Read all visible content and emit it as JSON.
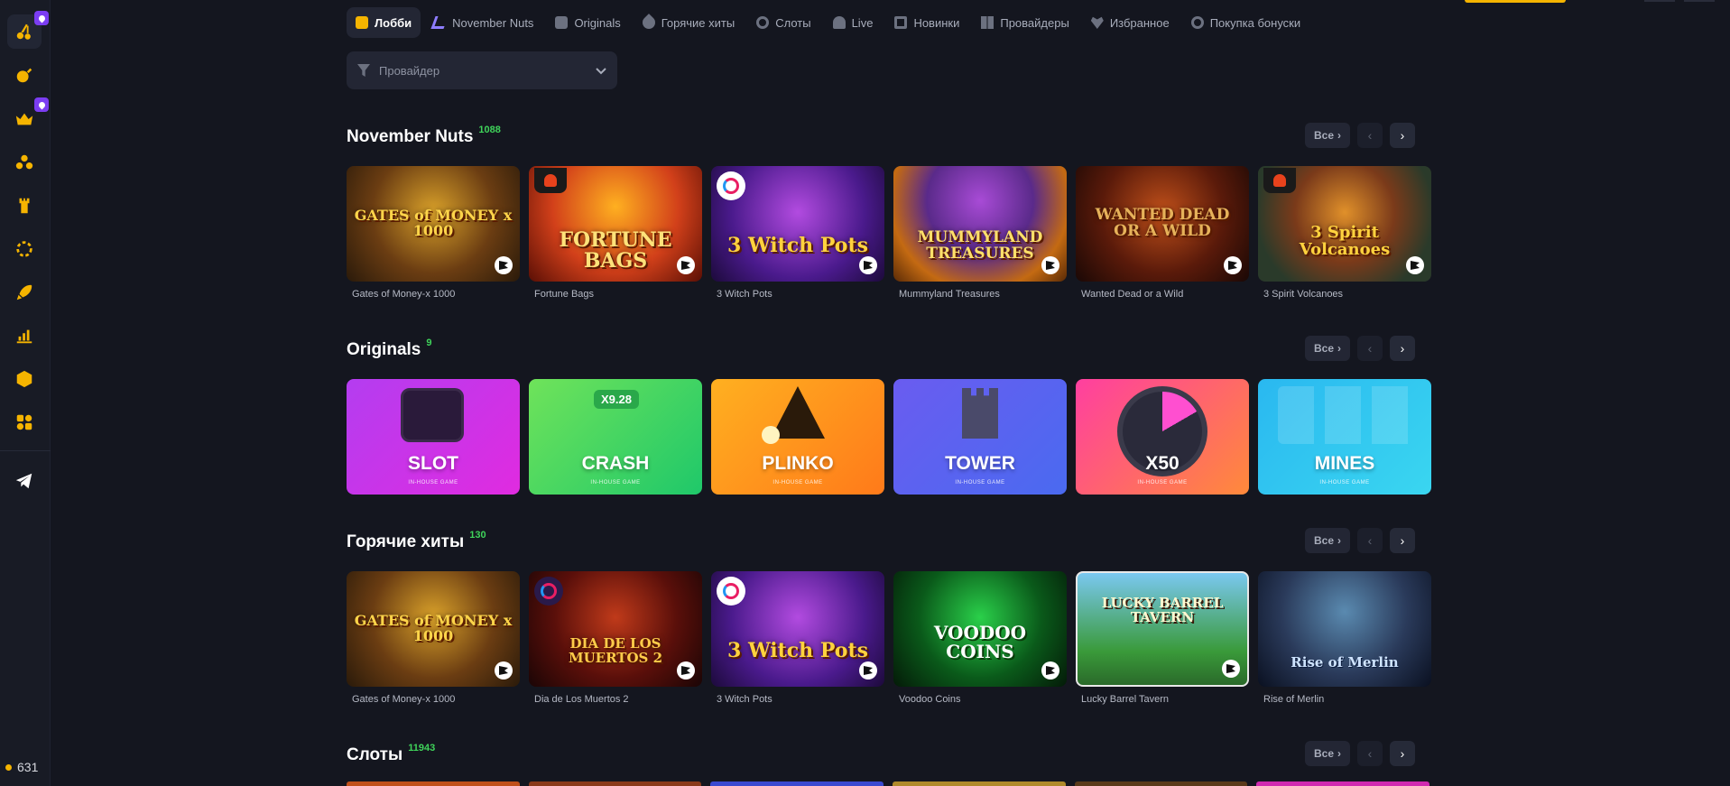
{
  "nav": {
    "items": [
      {
        "label": "Лобби",
        "icon": "lobby-icon",
        "active": true
      },
      {
        "label": "November Nuts",
        "icon": "category-icon",
        "active": false
      },
      {
        "label": "Originals",
        "icon": "originals-icon",
        "active": false
      },
      {
        "label": "Горячие хиты",
        "icon": "flame-icon",
        "active": false
      },
      {
        "label": "Слоты",
        "icon": "cherry-icon",
        "active": false
      },
      {
        "label": "Live",
        "icon": "live-dealer-icon",
        "active": false
      },
      {
        "label": "Новинки",
        "icon": "new-icon",
        "active": false
      },
      {
        "label": "Провайдеры",
        "icon": "providers-icon",
        "active": false
      },
      {
        "label": "Избранное",
        "icon": "heart-icon",
        "active": false
      },
      {
        "label": "Покупка бонуски",
        "icon": "bonus-buy-icon",
        "active": false
      }
    ]
  },
  "provider_select": {
    "placeholder": "Провайдер"
  },
  "sidebar": {
    "icons": [
      "cherry-icon",
      "bomb-icon",
      "crown-icon",
      "poker-chips-icon",
      "tower-icon",
      "wheel-icon",
      "rocket-icon",
      "chart-icon",
      "dice-icon",
      "grid-icon",
      "telegram-icon"
    ],
    "online_count": "631"
  },
  "sections": {
    "nuts": {
      "title": "November Nuts",
      "count": "1088",
      "all_label": "Все",
      "games": [
        {
          "name": "Gates of Money-x 1000",
          "art": "GATES of MONEY x 1000"
        },
        {
          "name": "Fortune Bags",
          "art": "FORTUNE BAGS"
        },
        {
          "name": "3 Witch Pots",
          "art": "3 Witch Pots"
        },
        {
          "name": "Mummyland Treasures",
          "art": "MUMMYLAND TREASURES"
        },
        {
          "name": "Wanted Dead or a Wild",
          "art": "WANTED DEAD OR A WILD"
        },
        {
          "name": "3 Spirit Volcanoes",
          "art": "3 Spirit Volcanoes"
        }
      ]
    },
    "originals": {
      "title": "Originals",
      "count": "9",
      "all_label": "Все",
      "games": [
        {
          "name": "SLOT",
          "sub": "IN-HOUSE GAME"
        },
        {
          "name": "CRASH",
          "sub": "IN-HOUSE GAME",
          "multiplier": "X9.28"
        },
        {
          "name": "PLINKO",
          "sub": "IN-HOUSE GAME"
        },
        {
          "name": "TOWER",
          "sub": "IN-HOUSE GAME"
        },
        {
          "name": "X50",
          "sub": "IN-HOUSE GAME"
        },
        {
          "name": "MINES",
          "sub": "IN-HOUSE GAME"
        }
      ]
    },
    "hot": {
      "title": "Горячие хиты",
      "count": "130",
      "all_label": "Все",
      "games": [
        {
          "name": "Gates of Money-x 1000",
          "art": "GATES of MONEY x 1000"
        },
        {
          "name": "Dia de Los Muertos 2",
          "art": "DIA DE LOS MUERTOS 2"
        },
        {
          "name": "3 Witch Pots",
          "art": "3 Witch Pots"
        },
        {
          "name": "Voodoo Coins",
          "art": "VOODOO COINS"
        },
        {
          "name": "Lucky Barrel Tavern",
          "art": "LUCKY BARREL TAVERN"
        },
        {
          "name": "Rise of Merlin",
          "art": "Rise of Merlin"
        }
      ]
    },
    "slots": {
      "title": "Слоты",
      "count": "11943",
      "all_label": "Все"
    }
  },
  "colors": {
    "accent": "#f5b400",
    "count_green": "#3fd35a",
    "background": "#14161f",
    "sidebar": "#181b25"
  }
}
